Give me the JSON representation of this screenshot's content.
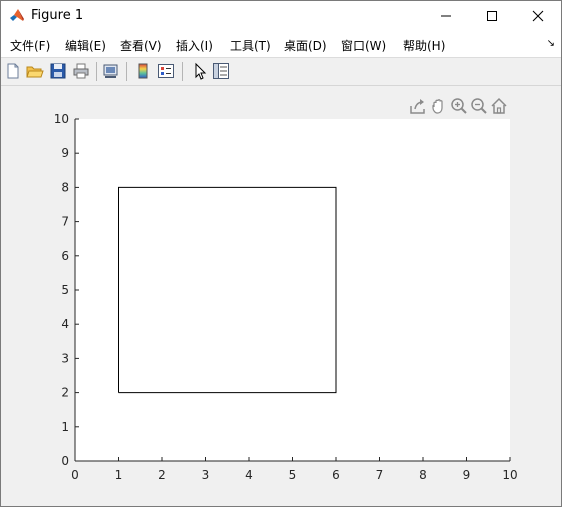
{
  "window": {
    "title": "Figure 1",
    "controls": {
      "minimize": "—",
      "maximize": "☐",
      "close": "✕"
    }
  },
  "menubar": {
    "items": [
      "文件(F)",
      "编辑(E)",
      "查看(V)",
      "插入(I)",
      "工具(T)",
      "桌面(D)",
      "窗口(W)",
      "帮助(H)"
    ],
    "overflow_glyph": "↘"
  },
  "toolbar": {
    "icons": [
      "new-figure-icon",
      "open-file-icon",
      "save-icon",
      "print-icon",
      "link-plot-icon",
      "insert-colorbar-icon",
      "insert-legend-icon",
      "edit-plot-icon",
      "property-inspector-icon"
    ]
  },
  "axes_toolbar": {
    "icons": [
      "export-icon",
      "pan-icon",
      "zoom-in-icon",
      "zoom-out-icon",
      "home-icon"
    ]
  },
  "chart_data": {
    "type": "line",
    "title": "",
    "xlabel": "",
    "ylabel": "",
    "xlim": [
      0,
      10
    ],
    "ylim": [
      0,
      10
    ],
    "xticks": [
      0,
      1,
      2,
      3,
      4,
      5,
      6,
      7,
      8,
      9,
      10
    ],
    "yticks": [
      0,
      1,
      2,
      3,
      4,
      5,
      6,
      7,
      8,
      9,
      10
    ],
    "grid": false,
    "series": [
      {
        "x": [
          1,
          6,
          6,
          1,
          1
        ],
        "y": [
          2,
          2,
          8,
          8,
          2
        ],
        "color": "#000000"
      }
    ]
  }
}
